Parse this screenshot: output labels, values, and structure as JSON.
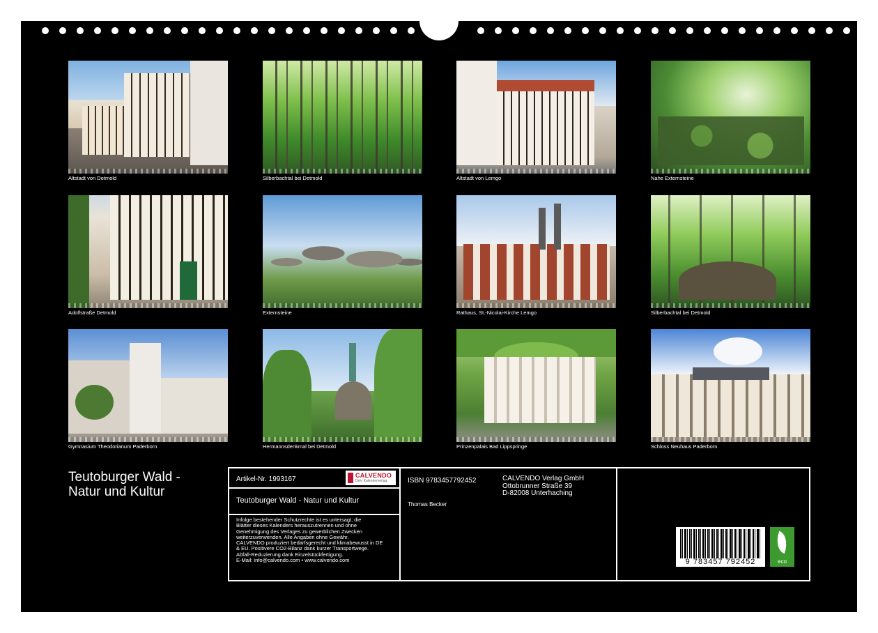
{
  "photos": [
    {
      "caption": "Altstadt von Detmold"
    },
    {
      "caption": "Silberbachtal bei Detmold"
    },
    {
      "caption": "Altstadt von Lemgo"
    },
    {
      "caption": "Nahe Externsteine"
    },
    {
      "caption": "Adolfstraße Detmold"
    },
    {
      "caption": "Externsteine"
    },
    {
      "caption": "Rathaus, St.-Nicolai-Kirche Lemgo"
    },
    {
      "caption": "Silberbachtal bei Detmold"
    },
    {
      "caption": "Gymnasium Theodorianum Paderborn"
    },
    {
      "caption": "Hermannsdenkmal bei Detmold"
    },
    {
      "caption": "Prinzenpalais Bad Lippspringe"
    },
    {
      "caption": "Schloss Neuhaus Paderborn"
    }
  ],
  "title": {
    "line1": "Teutoburger Wald -",
    "line2": "Natur und Kultur"
  },
  "info": {
    "article": "Artikel-Nr. 1993167",
    "logo_name": "CALVENDO",
    "logo_sub": "Dein Kalenderverlag",
    "product_title": "Teutoburger Wald - Natur und Kultur",
    "legal": [
      "Infolge bestehender Schutzrechte ist es untersagt, die",
      "Blätter dieses Kalenders herauszutrennen und ohne",
      "Genehmigung des Verlages zu gewerblichen Zwecken",
      "weiterzuverwenden. Alle Angaben ohne Gewähr.",
      "CALVENDO produziert bedarfsgerecht und klimabewusst in DE",
      "& EU. Positivere CO2-Bilanz dank kurzer Transportwege.",
      "Abfall-Reduzierung dank Einzelstückfertigung.",
      "E-Mail: info@calvendo.com • www.calvendo.com"
    ],
    "isbn": "ISBN 9783457792452",
    "author": "Thomas Becker",
    "publisher": [
      "CALVENDO Verlag GmbH",
      "Ottobrunner Straße 39",
      "D-82008 Unterhaching"
    ],
    "barcode_number": "9 783457 792452",
    "eco_label": "eco"
  }
}
